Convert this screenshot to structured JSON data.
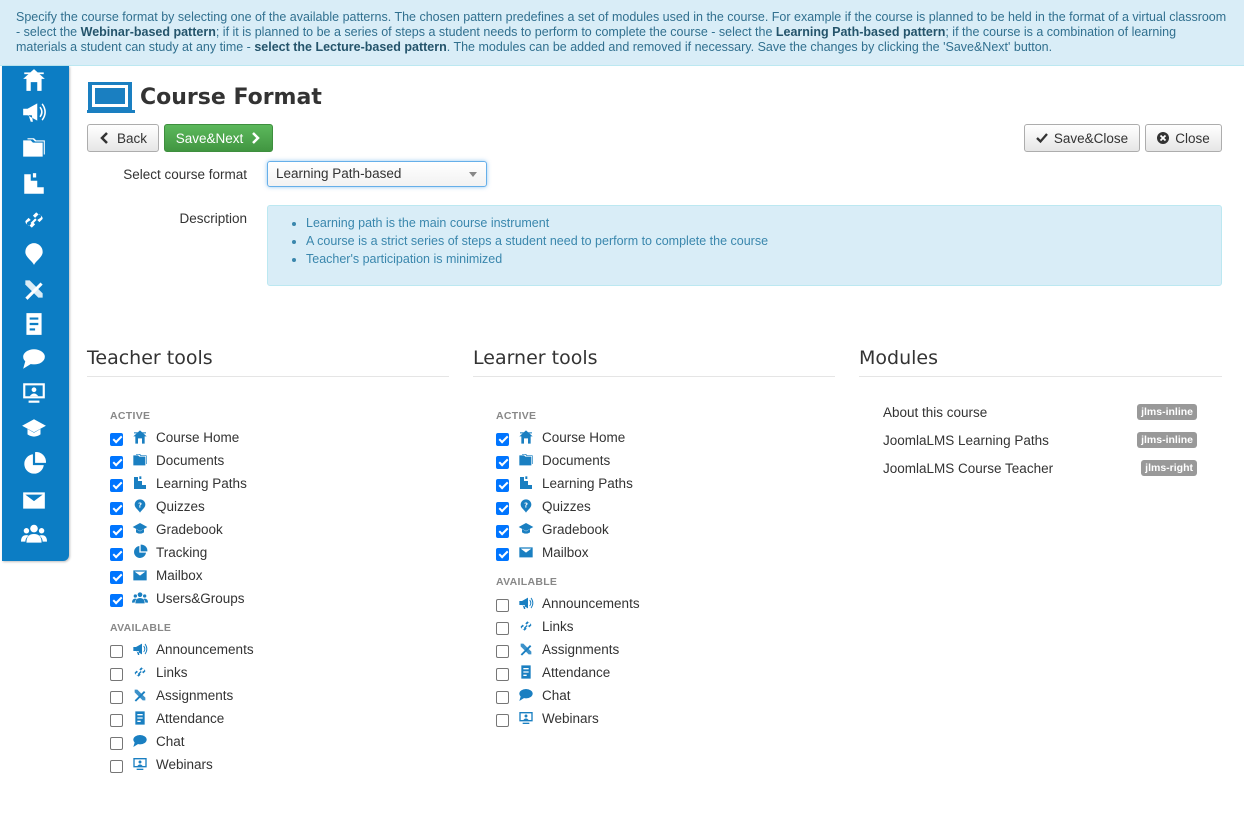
{
  "info": {
    "p1": "Specify the course format by selecting one of the available patterns. The chosen pattern predefines a set of modules used in the course. For example if the course is planned to be held in the format of a virtual classroom - select the ",
    "b1": "Webinar-based pattern",
    "p2": "; if it is planned to be a series of steps a student needs to perform to complete the course - select the ",
    "b2": "Learning Path-based pattern",
    "p3": "; if the course is a combination of learning materials a student can study at any time - ",
    "b3": "select the Lecture-based pattern",
    "p4": ". The modules can be added and removed if necessary. Save the changes by clicking the 'Save&Next' button."
  },
  "sidebar": {
    "icons": [
      "home-icon",
      "megaphone-icon",
      "folder-icon",
      "learning-path-icon",
      "link-icon",
      "quiz-icon",
      "assignment-icon",
      "attendance-icon",
      "chat-icon",
      "webinar-icon",
      "gradebook-icon",
      "tracking-icon",
      "mailbox-icon",
      "users-icon"
    ]
  },
  "page": {
    "title": "Course Format"
  },
  "toolbar": {
    "back": "Back",
    "save_next": "Save&Next",
    "save_close": "Save&Close",
    "close": "Close"
  },
  "form": {
    "select_label": "Select course format",
    "select_value": "Learning Path-based",
    "description_label": "Description",
    "description_items": [
      "Learning path is the main course instrument",
      "A course is a strict series of steps a student need to perform to complete the course",
      "Teacher's participation is minimized"
    ]
  },
  "teacher": {
    "title": "Teacher tools",
    "active_label": "ACTIVE",
    "available_label": "AVAILABLE",
    "active": [
      {
        "label": "Course Home",
        "icon": "home-icon"
      },
      {
        "label": "Documents",
        "icon": "folder-icon"
      },
      {
        "label": "Learning Paths",
        "icon": "learning-path-icon"
      },
      {
        "label": "Quizzes",
        "icon": "quiz-icon"
      },
      {
        "label": "Gradebook",
        "icon": "gradebook-icon"
      },
      {
        "label": "Tracking",
        "icon": "tracking-icon"
      },
      {
        "label": "Mailbox",
        "icon": "mailbox-icon"
      },
      {
        "label": "Users&Groups",
        "icon": "users-icon"
      }
    ],
    "available": [
      {
        "label": "Announcements",
        "icon": "megaphone-icon"
      },
      {
        "label": "Links",
        "icon": "link-icon"
      },
      {
        "label": "Assignments",
        "icon": "assignment-icon"
      },
      {
        "label": "Attendance",
        "icon": "attendance-icon"
      },
      {
        "label": "Chat",
        "icon": "chat-icon"
      },
      {
        "label": "Webinars",
        "icon": "webinar-icon"
      }
    ]
  },
  "learner": {
    "title": "Learner tools",
    "active_label": "ACTIVE",
    "available_label": "AVAILABLE",
    "active": [
      {
        "label": "Course Home",
        "icon": "home-icon"
      },
      {
        "label": "Documents",
        "icon": "folder-icon"
      },
      {
        "label": "Learning Paths",
        "icon": "learning-path-icon"
      },
      {
        "label": "Quizzes",
        "icon": "quiz-icon"
      },
      {
        "label": "Gradebook",
        "icon": "gradebook-icon"
      },
      {
        "label": "Mailbox",
        "icon": "mailbox-icon"
      }
    ],
    "available": [
      {
        "label": "Announcements",
        "icon": "megaphone-icon"
      },
      {
        "label": "Links",
        "icon": "link-icon"
      },
      {
        "label": "Assignments",
        "icon": "assignment-icon"
      },
      {
        "label": "Attendance",
        "icon": "attendance-icon"
      },
      {
        "label": "Chat",
        "icon": "chat-icon"
      },
      {
        "label": "Webinars",
        "icon": "webinar-icon"
      }
    ]
  },
  "modules": {
    "title": "Modules",
    "items": [
      {
        "label": "About this course",
        "badge": "jlms-inline"
      },
      {
        "label": "JoomlaLMS Learning Paths",
        "badge": "jlms-inline"
      },
      {
        "label": "JoomlaLMS Course Teacher",
        "badge": "jlms-right"
      }
    ]
  },
  "colors": {
    "sidebar": "#0c7dc4",
    "accent": "#1a7fc1",
    "primary_button": "#5cb85c",
    "info_bg": "#d9edf7"
  }
}
